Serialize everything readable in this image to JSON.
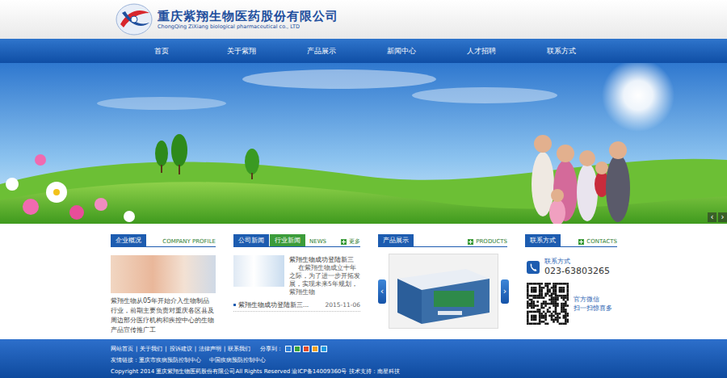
{
  "header": {
    "company_name": "重庆紫翔生物医药股份有限公司",
    "company_name_en": "ChongQing ZiXiang biological pharmaceutical co., LTD"
  },
  "nav": [
    {
      "label": "首页",
      "selected": false
    },
    {
      "label": "关于紫翔",
      "selected": false
    },
    {
      "label": "产品展示",
      "selected": false
    },
    {
      "label": "新闻中心",
      "selected": false
    },
    {
      "label": "人才招聘",
      "selected": false
    },
    {
      "label": "联系方式",
      "selected": false
    }
  ],
  "banner": {
    "prev": "‹",
    "next": "›"
  },
  "profile": {
    "title": "企业概况",
    "subtitle": "COMPANY PROFILE",
    "text": "紫翔生物从05年开始介入生物制品行业，前期主要负责对重庆各区县及周边部分医疗机构和疾控中心的生物产品宣传推广工"
  },
  "news": {
    "tabs": [
      {
        "label": "公司新闻",
        "selected": true
      },
      {
        "label": "行业新闻",
        "selected": false
      }
    ],
    "subtitle": "NEWS",
    "more": "更多",
    "featured_title": "紫翔生物成功登陆新三",
    "featured_text": "在紫翔生物成立十年之际，为了进一步开拓发展，实现未来5年规划，紫翔生物",
    "items": [
      {
        "title": "紫翔生物成功登陆新三...",
        "date": "2015-11-06"
      }
    ]
  },
  "products": {
    "title": "产品展示",
    "subtitle": "PRODUCTS",
    "prev": "‹",
    "next": "›"
  },
  "contact": {
    "title": "联系方式",
    "subtitle": "CONTACTS",
    "phone_label": "联系方式",
    "phone": "023-63803265",
    "wechat_label": "官方微信",
    "wechat_hint": "扫一扫惊喜多"
  },
  "footer": {
    "links": [
      "网站首页",
      "关于我们",
      "投诉建议",
      "法律声明",
      "联系我们"
    ],
    "separator": "|",
    "share_label": "分享到：",
    "friend_label": "友情链接：",
    "friend_links": [
      "重庆市疾病预防控制中心",
      "中国疾病预防控制中心"
    ],
    "copyright": "Copyright 2014 重庆紫翔生物医药股份有限公司All Rights Reserved 渝ICP备14009360号 技术支持：南星科技"
  }
}
